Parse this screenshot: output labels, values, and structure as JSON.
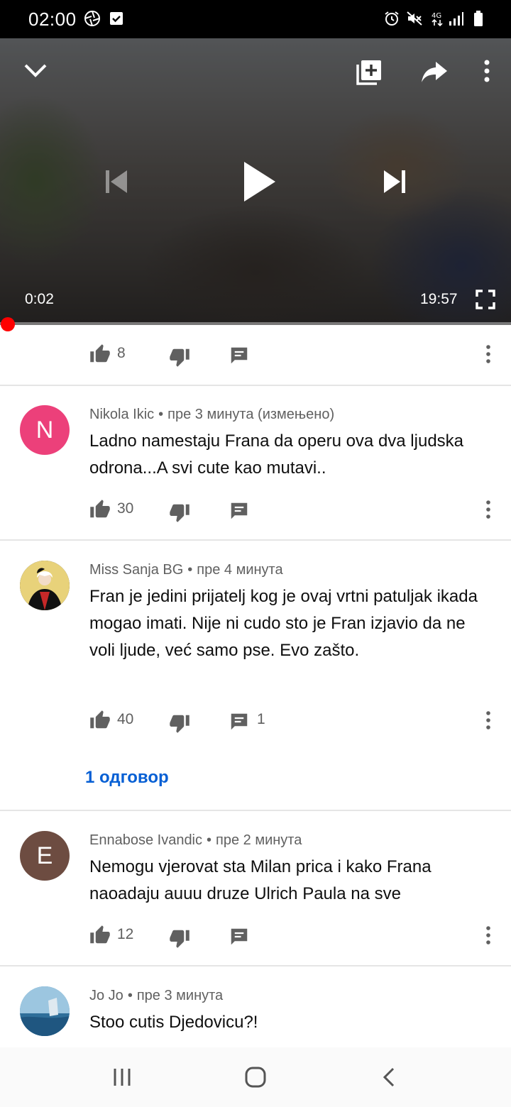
{
  "status_bar": {
    "time": "02:00",
    "icons": [
      "aperture-icon",
      "check-box-icon",
      "alarm-icon",
      "mute-icon",
      "4g-icon",
      "signal-icon",
      "battery-icon"
    ]
  },
  "player": {
    "current_time": "0:02",
    "duration": "19:57",
    "progress_fraction": 0.0017,
    "icons": [
      "collapse-chevron-icon",
      "add-to-queue-icon",
      "share-icon",
      "more-vert-icon",
      "previous-icon",
      "play-icon",
      "next-icon",
      "fullscreen-icon"
    ]
  },
  "first_actions": {
    "likes": "8"
  },
  "comments": [
    {
      "avatar_letter": "N",
      "avatar_color": "#ec407a",
      "author": "Nikola Ikic",
      "time": "пре 3 минута (измењено)",
      "text": "Ladno namestaju Frana da operu ova dva ljudska odrona...A svi cute kao mutavi..",
      "likes": "30",
      "reply_count": ""
    },
    {
      "avatar_letter": "",
      "avatar_color": "#1a1a1a",
      "author": "Miss Sanja BG",
      "time": "пре 4 минута",
      "text": "Fran je jedini prijatelj kog je ovaj vrtni patuljak ikada mogao imati. Nije ni cudo sto je Fran izjavio da ne voli ljude, već samo pse. Evo zašto.",
      "likes": "40",
      "reply_count": "1",
      "replies_label": "1 одговор"
    },
    {
      "avatar_letter": "E",
      "avatar_color": "#6d4c41",
      "author": "Ennabose Ivandic",
      "time": "пре 2 минута",
      "text": "Nemogu vjerovat sta Milan prica i kako Frana naoadaju auuu druze Ulrich Paula na sve",
      "likes": "12",
      "reply_count": ""
    },
    {
      "avatar_letter": "",
      "avatar_color": "#4a8fb8",
      "author": "Jo Jo",
      "time": "пре 3 минута",
      "text": "Stoo cutis Djedovicu?!"
    }
  ],
  "nav_bar": {
    "icons": [
      "recent-apps-icon",
      "home-icon",
      "back-icon"
    ]
  }
}
